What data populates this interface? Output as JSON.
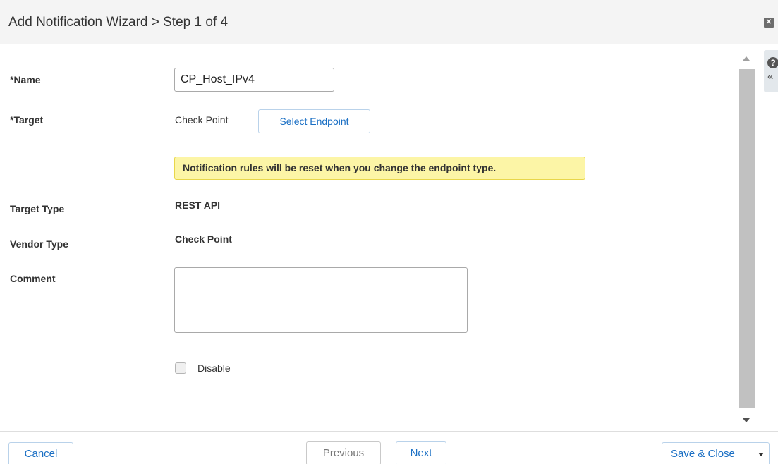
{
  "dialog": {
    "title": "Add Notification Wizard > Step 1 of 4",
    "close_icon": "close-icon",
    "close_glyph": "✕"
  },
  "form": {
    "name_label": "*Name",
    "name_value": "CP_Host_IPv4",
    "target_label": "*Target",
    "target_value": "Check Point",
    "select_endpoint_label": "Select Endpoint",
    "warning_text": "Notification rules will be reset when you change the endpoint type.",
    "target_type_label": "Target Type",
    "target_type_value": "REST API",
    "vendor_type_label": "Vendor Type",
    "vendor_type_value": "Check Point",
    "comment_label": "Comment",
    "comment_value": "",
    "disable_label": "Disable",
    "disable_checked": false
  },
  "help_panel": {
    "help_icon": "help-icon",
    "help_glyph": "?",
    "collapse_icon": "double-chevron-left-icon",
    "collapse_glyph": "«"
  },
  "footer": {
    "cancel_label": "Cancel",
    "previous_label": "Previous",
    "next_label": "Next",
    "save_close_label": "Save & Close"
  },
  "colors": {
    "warning_bg": "#fcf5a6",
    "link_blue": "#1a6fc4",
    "titlebar_bg": "#f4f4f4"
  }
}
